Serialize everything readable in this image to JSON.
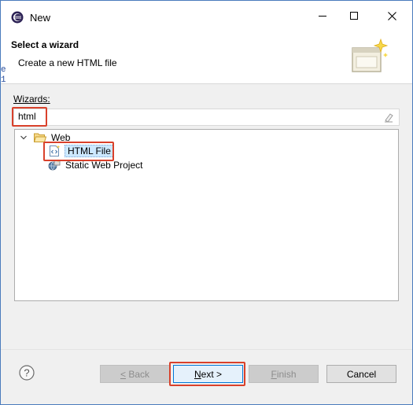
{
  "window": {
    "title": "New"
  },
  "banner": {
    "title": "Select a wizard",
    "subtitle": "Create a new HTML file",
    "background_edge_chars": [
      "e",
      "1"
    ]
  },
  "wizards": {
    "label": "Wizards:",
    "filter_value": "html"
  },
  "tree": {
    "items": [
      {
        "label": "Web",
        "icon": "folder-open-icon",
        "expanded": true
      },
      {
        "label": "HTML File",
        "icon": "html-file-icon",
        "selected": true
      },
      {
        "label": "Static Web Project",
        "icon": "web-project-icon"
      }
    ]
  },
  "buttons": {
    "back": "< Back",
    "next": "Next >",
    "finish": "Finish",
    "cancel": "Cancel"
  },
  "colors": {
    "highlight": "#d9412b",
    "window_border": "#4a7bbd",
    "selection": "#cce8ff",
    "default_button_border": "#0078d7"
  }
}
